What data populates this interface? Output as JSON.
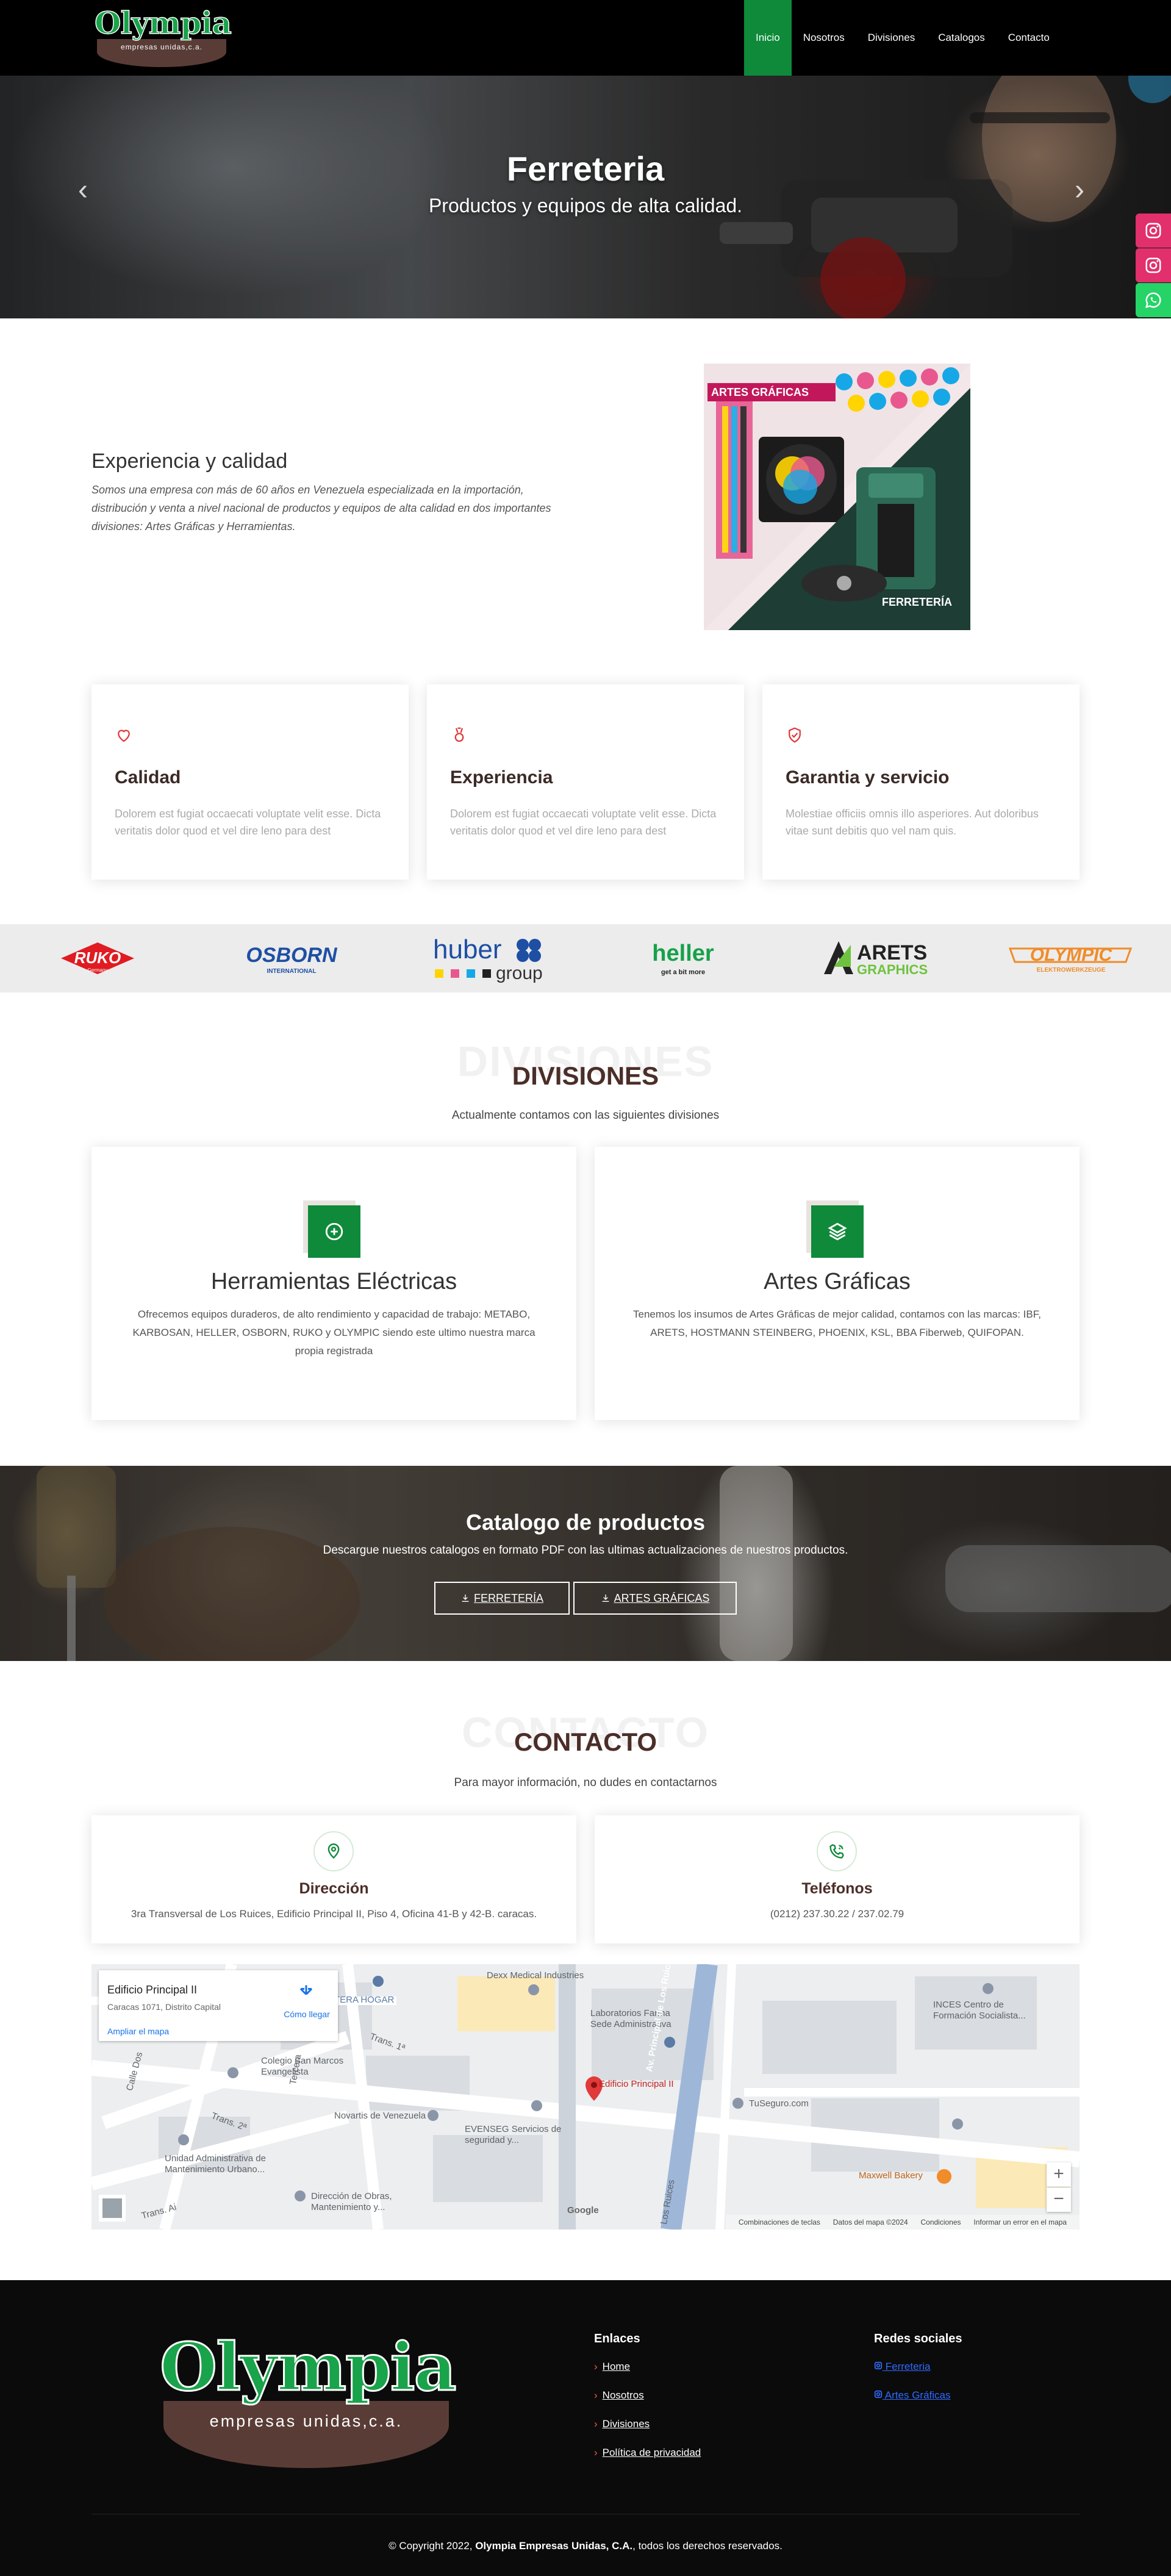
{
  "header": {
    "logo_word": "Olympia",
    "logo_sub": "empresas unidas,c.a.",
    "nav": [
      "Inicio",
      "Nosotros",
      "Divisiones",
      "Catalogos",
      "Contacto"
    ]
  },
  "hero": {
    "title": "Ferreteria",
    "subtitle": "Productos y equipos de alta calidad.",
    "prev": "‹",
    "next": "›"
  },
  "about": {
    "title": "Experiencia y calidad",
    "text": "Somos una empresa con más de 60 años en Venezuela especializada en la importación, distribución y venta a nivel nacional de productos y equipos de alta calidad en dos importantes divisiones: Artes Gráficas y Herramientas.",
    "img_label_top": "ARTES GRÁFICAS",
    "img_label_bottom": "FERRETERÍA"
  },
  "features": [
    {
      "title": "Calidad",
      "text": "Dolorem est fugiat occaecati voluptate velit esse. Dicta veritatis dolor quod et vel dire leno para dest",
      "icon": "heart-icon"
    },
    {
      "title": "Experiencia",
      "text": "Dolorem est fugiat occaecati voluptate velit esse. Dicta veritatis dolor quod et vel dire leno para dest",
      "icon": "medal-icon"
    },
    {
      "title": "Garantia y servicio",
      "text": "Molestiae officiis omnis illo asperiores. Aut doloribus vitae sunt debitis quo vel nam quis.",
      "icon": "shield-check-icon"
    }
  ],
  "brands": {
    "ruko": "RUKO",
    "ruko_sub": "Germany",
    "osborn": "OSBORN",
    "osborn_sub": "INTERNATIONAL",
    "huber_a": "huber",
    "huber_b": "group",
    "heller_a": "heller",
    "heller_b": "get a bit more",
    "arets_a": "ARETS",
    "arets_b": "GRAPHICS",
    "olympic_a": "OLYMPIC",
    "olympic_b": "ELEKTROWERKZEUGE"
  },
  "divisiones": {
    "bg_title": "DIVISIONES",
    "title": "DIVISIONES",
    "subtitle": "Actualmente contamos con las siguientes divisiones",
    "cards": [
      {
        "title": "Herramientas Eléctricas",
        "text": "Ofrecemos equipos duraderos, de alto rendimiento y capacidad de trabajo: METABO, KARBOSAN, HELLER, OSBORN, RUKO y OLYMPIC siendo este ultimo nuestra marca propia registrada",
        "icon": "plus-circle-icon"
      },
      {
        "title": "Artes Gráficas",
        "text": "Tenemos los insumos de Artes Gráficas de mejor calidad, contamos con las marcas: IBF, ARETS, HOSTMANN STEINBERG, PHOENIX, KSL, BBA Fiberweb, QUIFOPAN.",
        "icon": "layers-icon"
      }
    ]
  },
  "catalog": {
    "title": "Catalogo de productos",
    "subtitle": "Descargue nuestros catalogos en formato PDF con las ultimas actualizaciones de nuestros productos.",
    "buttons": [
      "FERRETERÍA",
      "ARTES GRÁFICAS"
    ]
  },
  "contacto": {
    "bg_title": "CONTACTO",
    "title": "CONTACTO",
    "subtitle": "Para mayor información, no dudes en contactarnos",
    "cards": [
      {
        "title": "Dirección",
        "text": "3ra Transversal de Los Ruices, Edificio Principal II, Piso 4, Oficina 41-B y 42-B. caracas.",
        "icon": "map-pin-icon"
      },
      {
        "title": "Teléfonos",
        "text": "(0212) 237.30.22 / 237.02.79",
        "icon": "phone-icon"
      }
    ]
  },
  "map": {
    "card_title": "Edificio Principal II",
    "card_address": "Caracas 1071, Distrito Capital",
    "card_link": "Ampliar el mapa",
    "directions": "Cómo llegar",
    "pin_label": "Edificio Principal II",
    "labels": [
      "Dexx Medical Industries",
      "Laboratorios Farma Sede Administrativa",
      "INCES Centro de Formación Socialista...",
      "TERA HOGAR",
      "Colegio San Marcos Evangelista",
      "Novartis de Venezuela",
      "EVENSEG Servicios de seguridad y...",
      "TuSeguro.com",
      "Maxwell Bakery",
      "Unidad Administrativa de Mantenimiento Urbano...",
      "Dirección de Obras, Mantenimiento y...",
      "Av. Principal de Los Ruices",
      "Los Ruices",
      "Trans. 1ª",
      "Trans. 2ª",
      "Tercera",
      "Calle Dos",
      "Trans. Ai"
    ],
    "footer": [
      "Combinaciones de teclas",
      "Datos del mapa ©2024",
      "Condiciones",
      "Informar un error en el mapa"
    ],
    "zoom_in": "+",
    "zoom_out": "−",
    "google": "Google"
  },
  "footer": {
    "logo_word": "Olympia",
    "logo_sub": "empresas unidas,c.a.",
    "links_title": "Enlaces",
    "links": [
      "Home",
      "Nosotros",
      "Divisiones",
      "Política de privacidad"
    ],
    "social_title": "Redes sociales",
    "social": [
      "Ferreteria",
      "Artes Gráficas"
    ],
    "copy_pre": "© Copyright 2022,",
    "copy_brand": "Olympia Empresas Unidas, C.A.",
    "copy_post": "todos los derechos reservados."
  },
  "colors": {
    "brand_green": "#0e8a3a",
    "brand_brown": "#4b2e28",
    "accent_red": "#e03a3a",
    "instagram": "#e1306c",
    "whatsapp": "#25d366"
  }
}
